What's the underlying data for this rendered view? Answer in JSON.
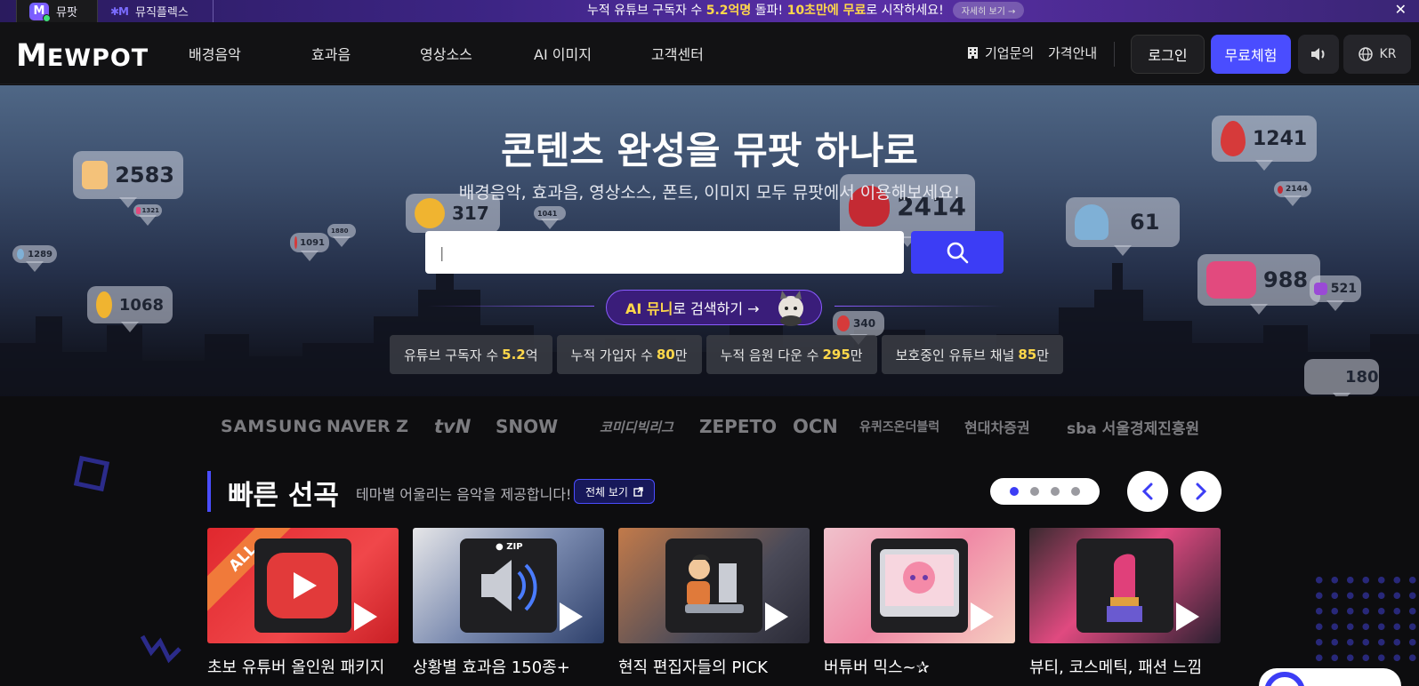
{
  "topbar": {
    "tabs": [
      {
        "label": "뮤팟"
      },
      {
        "label": "뮤직플렉스"
      }
    ],
    "promo": {
      "pre": "누적 유튜브 구독자 수",
      "highlight1": "5.2억명",
      "mid": "돌파!",
      "highlight2": "10초만에 무료",
      "post": "로 시작하세요!",
      "more": "자세히 보기 →"
    }
  },
  "nav": {
    "brand": "MEWPOT",
    "menu": [
      "배경음악",
      "효과음",
      "영상소스",
      "AI 이미지",
      "고객센터"
    ],
    "corporate": "기업문의",
    "pricing": "가격안내",
    "login": "로그인",
    "free_trial": "무료체험",
    "language": "KR"
  },
  "hero": {
    "title": "콘텐츠 완성을 뮤팟 하나로",
    "subtitle": "배경음악, 효과음, 영상소스, 폰트, 이미지 모두 뮤팟에서 이용해보세요!",
    "search_placeholder": "|",
    "ai": {
      "highlight": "AI 뮤니",
      "rest": "로 검색하기 →"
    },
    "stats": [
      {
        "label": "유튜브 구독자 수",
        "value": "5.2",
        "unit": "억"
      },
      {
        "label": "누적 가입자 수",
        "value": "80",
        "unit": "만"
      },
      {
        "label": "누적 음원 다운 수",
        "value": "295",
        "unit": "만"
      },
      {
        "label": "보호중인 유튜브 채널",
        "value": "85",
        "unit": "만"
      }
    ],
    "bubbles": [
      "2583",
      "317",
      "1041",
      "2414",
      "61",
      "1241",
      "2144",
      "1289",
      "1091",
      "1880",
      "1068",
      "340",
      "988",
      "521",
      "180",
      "1321"
    ]
  },
  "logos": [
    "SAMSUNG",
    "NAVER Z",
    "tvN",
    "SNOW",
    "코미디빅리그",
    "ZEPETO",
    "OCN",
    "유퀴즈온더블럭",
    "현대차증권",
    "sba 서울경제진흥원"
  ],
  "quick_pick": {
    "title": "빠른 선곡",
    "desc": "테마별 어울리는 음악을 제공합니다!",
    "view_all": "전체 보기",
    "cards": [
      {
        "label": "초보 유튜버 올인원 패키지",
        "badge": "ALL"
      },
      {
        "label": "상황별 효과음 150종+",
        "badge": "ZIP"
      },
      {
        "label": "현직 편집자들의 PICK"
      },
      {
        "label": "버튜버 믹스~✰"
      },
      {
        "label": "뷰티, 코스메틱, 패션 느낌"
      }
    ]
  },
  "colors": {
    "accent": "#4a4dff",
    "highlight": "#ffd84a",
    "ai_purple": "#3a1d7a"
  }
}
